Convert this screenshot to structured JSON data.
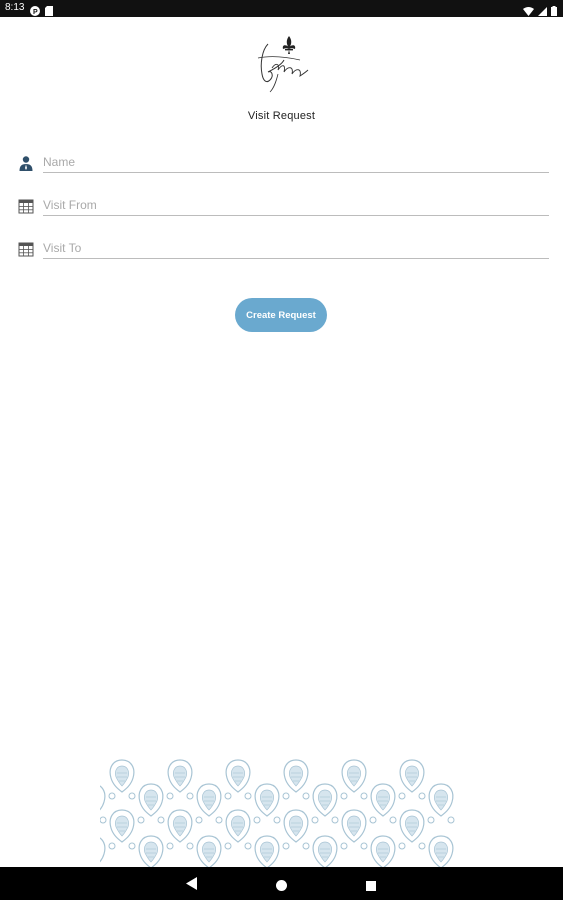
{
  "status_bar": {
    "time": "8:13",
    "icons_left": [
      "notification-p-icon",
      "sd-card-icon"
    ],
    "icons_right": [
      "wifi-icon",
      "signal-icon",
      "battery-icon"
    ]
  },
  "logo": {
    "name": "brand-logo-icon"
  },
  "page": {
    "title": "Visit Request"
  },
  "form": {
    "fields": [
      {
        "icon": "person-icon",
        "placeholder": "Name",
        "value": ""
      },
      {
        "icon": "calendar-icon",
        "placeholder": "Visit From",
        "value": ""
      },
      {
        "icon": "calendar-icon",
        "placeholder": "Visit To",
        "value": ""
      }
    ],
    "submit_label": "Create Request"
  },
  "colors": {
    "accent": "#6aa9cf",
    "pattern": "#a8c4d4",
    "icon_dark": "#2f4f6a"
  },
  "navigation": {
    "buttons": [
      "back-icon",
      "home-icon",
      "recents-icon"
    ]
  }
}
